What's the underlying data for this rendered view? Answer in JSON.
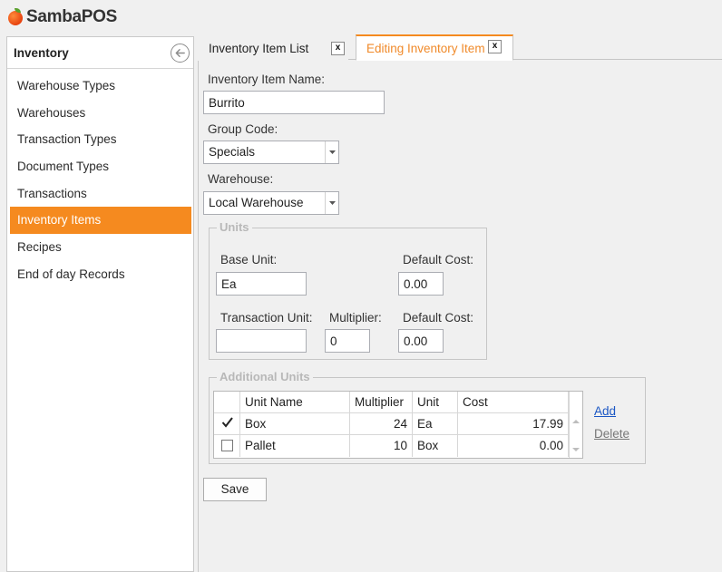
{
  "app": {
    "logo_text": "SambaPOS",
    "brand_color": "#f58a1f"
  },
  "sidebar": {
    "title": "Inventory",
    "items": [
      {
        "label": "Warehouse Types",
        "active": false
      },
      {
        "label": "Warehouses",
        "active": false
      },
      {
        "label": "Transaction Types",
        "active": false
      },
      {
        "label": "Document Types",
        "active": false
      },
      {
        "label": "Transactions",
        "active": false
      },
      {
        "label": "Inventory Items",
        "active": true
      },
      {
        "label": "Recipes",
        "active": false
      },
      {
        "label": "End of day Records",
        "active": false
      }
    ]
  },
  "tabs": [
    {
      "label": "Inventory Item List",
      "close": "x",
      "active": false
    },
    {
      "label": "Editing Inventory Item",
      "close": "x",
      "active": true
    }
  ],
  "form": {
    "name_label": "Inventory Item Name:",
    "name_value": "Burrito",
    "group_label": "Group Code:",
    "group_value": "Specials",
    "warehouse_label": "Warehouse:",
    "warehouse_value": "Local Warehouse",
    "units": {
      "title": "Units",
      "base_unit_label": "Base Unit:",
      "base_unit_value": "Ea",
      "default_cost_label": "Default Cost:",
      "default_cost_value": "0.00",
      "transaction_unit_label": "Transaction Unit:",
      "transaction_unit_value": "",
      "multiplier_label": "Multiplier:",
      "multiplier_value": "0",
      "default_cost2_label": "Default Cost:",
      "default_cost2_value": "0.00"
    },
    "additional_units": {
      "title": "Additional Units",
      "columns": [
        "Unit Name",
        "Multiplier",
        "Unit",
        "Cost"
      ],
      "rows": [
        {
          "checked": true,
          "unit_name": "Box",
          "multiplier": "24",
          "unit": "Ea",
          "cost": "17.99"
        },
        {
          "checked": false,
          "unit_name": "Pallet",
          "multiplier": "10",
          "unit": "Box",
          "cost": "0.00"
        }
      ],
      "add_label": "Add",
      "delete_label": "Delete"
    },
    "save_label": "Save"
  }
}
